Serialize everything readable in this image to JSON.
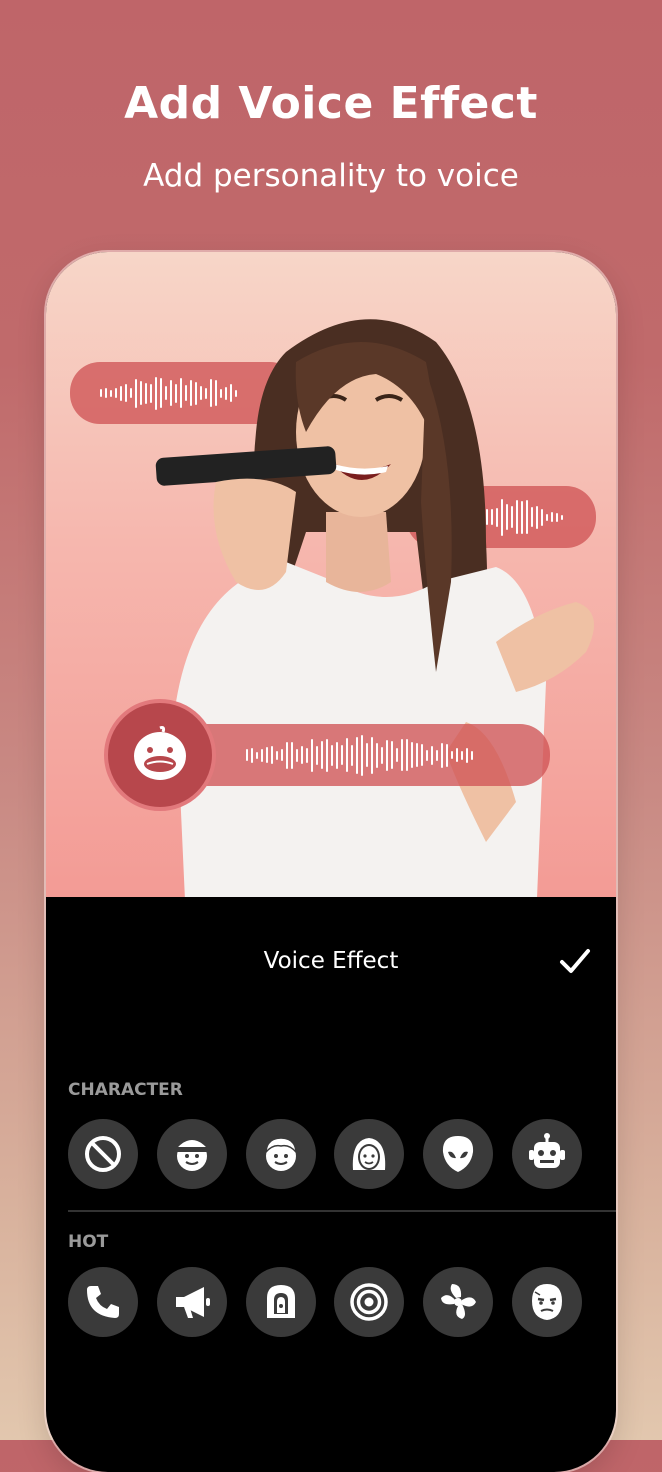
{
  "hero": {
    "title": "Add Voice Effect",
    "subtitle": "Add personality to voice"
  },
  "panel": {
    "title": "Voice Effect",
    "confirm_icon": "checkmark-icon"
  },
  "sections": {
    "character": {
      "label": "CHARACTER",
      "items": [
        "none-icon",
        "boy-icon",
        "man-icon",
        "woman-icon",
        "alien-icon",
        "robot-icon"
      ]
    },
    "hot": {
      "label": "HOT",
      "items": [
        "phone-icon",
        "megaphone-icon",
        "cave-icon",
        "echo-icon",
        "fan-icon",
        "zombie-icon"
      ]
    }
  },
  "colors": {
    "accent": "#bf6569",
    "pill": "#cf5456",
    "panel_bg": "#000000",
    "button_bg": "#3a3a3a"
  }
}
